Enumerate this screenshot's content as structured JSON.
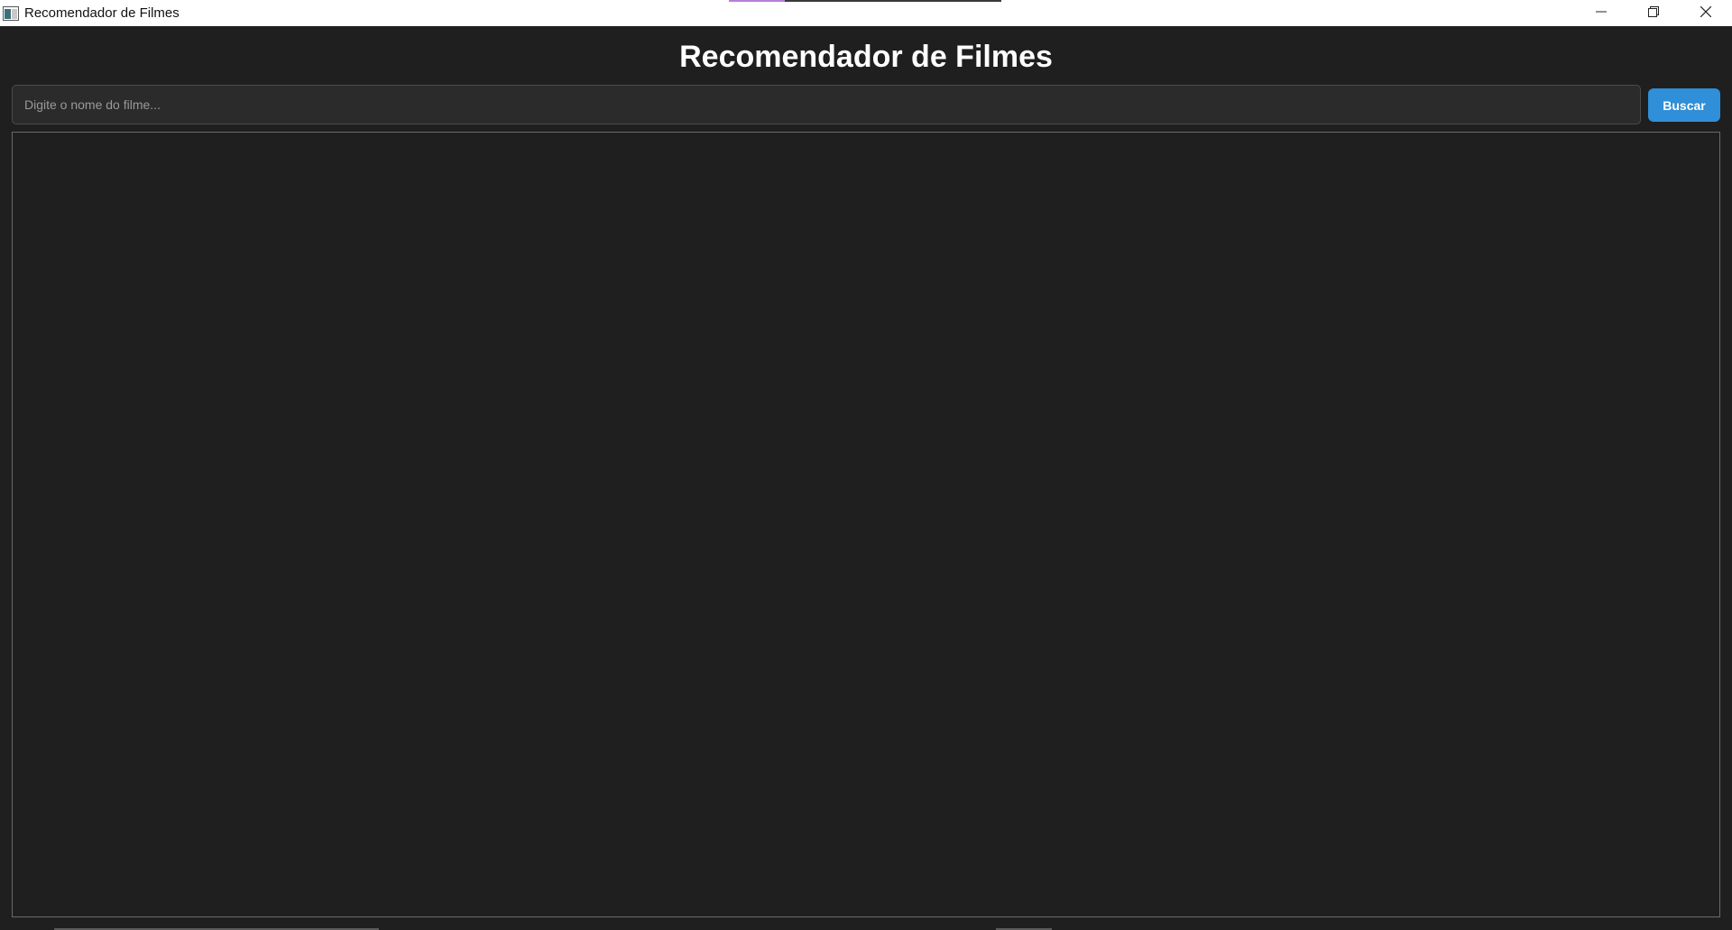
{
  "window": {
    "title": "Recomendador de Filmes",
    "controls": {
      "minimize": "minimize-icon",
      "maximize": "restore-icon",
      "close": "close-icon"
    }
  },
  "header": {
    "title": "Recomendador de Filmes"
  },
  "search": {
    "placeholder": "Digite o nome do filme...",
    "value": "",
    "button_label": "Buscar"
  },
  "results": {
    "items": []
  },
  "colors": {
    "background": "#1f1f1f",
    "accent": "#2f8fd8",
    "input_bg": "#2b2b2b"
  }
}
